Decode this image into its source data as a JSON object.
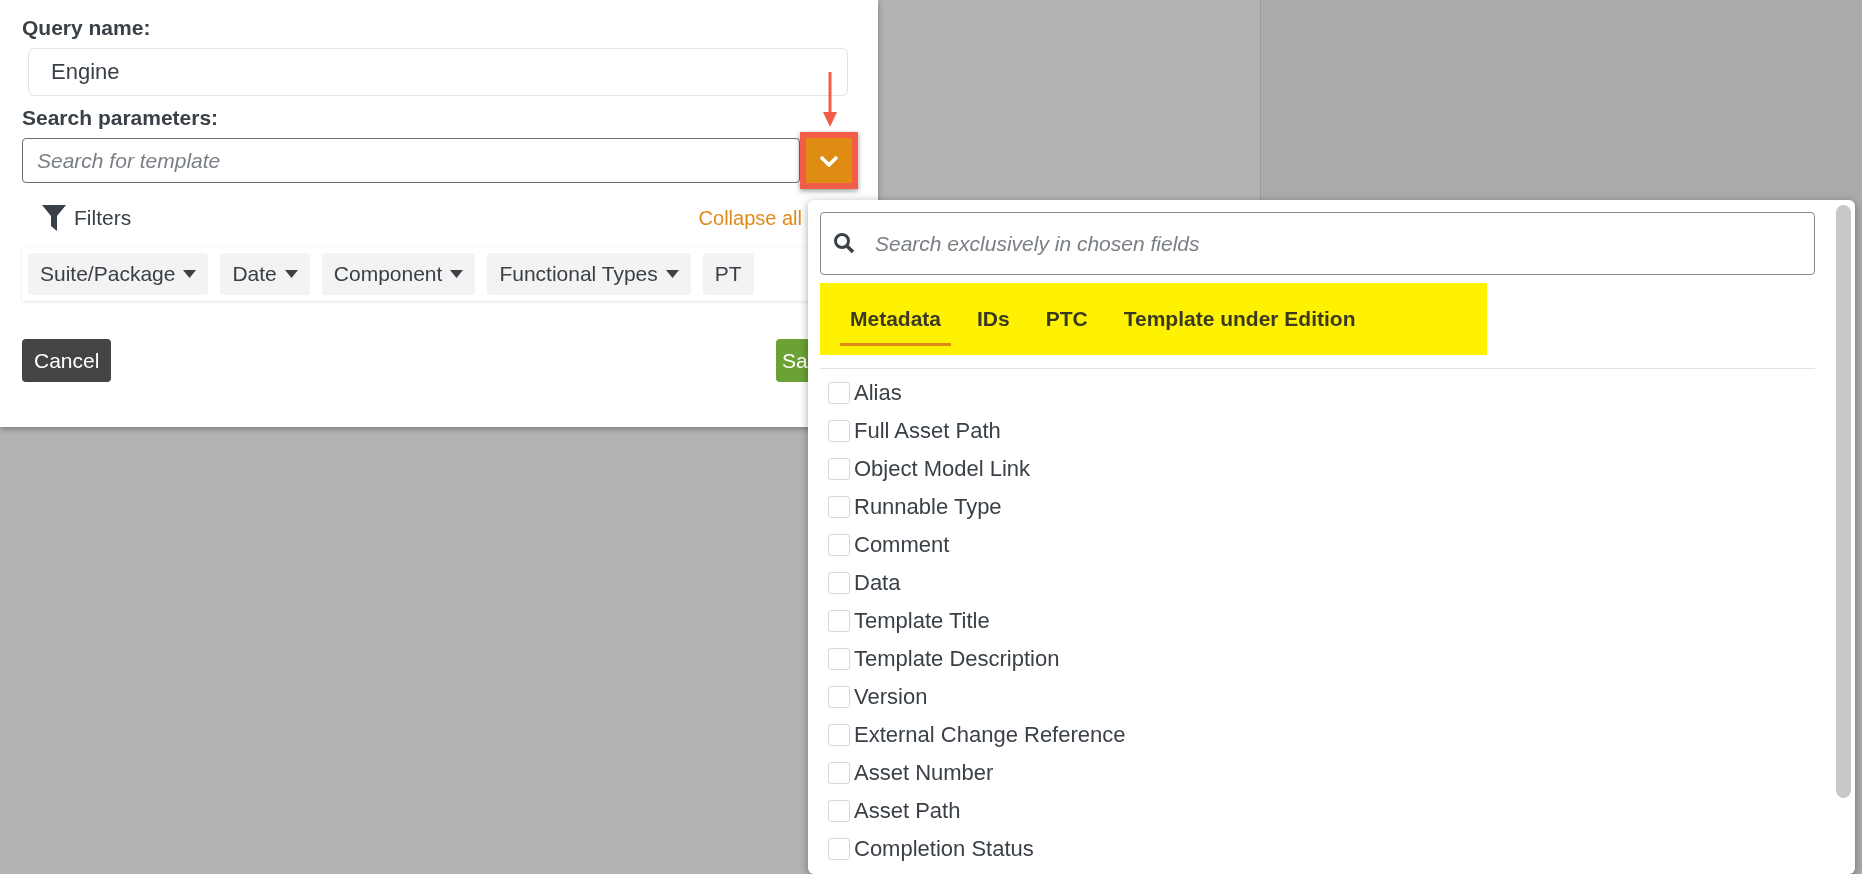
{
  "dialog": {
    "query_name_label": "Query name:",
    "query_name_value": "Engine",
    "search_label": "Search parameters:",
    "search_placeholder": "Search for template",
    "filters_label": "Filters",
    "collapse_all": "Collapse all",
    "chips": [
      "Suite/Package",
      "Date",
      "Component",
      "Functional Types",
      "PT"
    ],
    "cancel": "Cancel",
    "save": "Sa"
  },
  "dropdown": {
    "search_placeholder": "Search exclusively in chosen fields",
    "tabs": [
      {
        "label": "Metadata",
        "selected": true
      },
      {
        "label": "IDs",
        "selected": false
      },
      {
        "label": "PTC",
        "selected": false
      },
      {
        "label": "Template under Edition",
        "selected": false
      }
    ],
    "fields": [
      {
        "label": "Alias",
        "checked": false
      },
      {
        "label": "Full Asset Path",
        "checked": false
      },
      {
        "label": "Object Model Link",
        "checked": false
      },
      {
        "label": "Runnable Type",
        "checked": false
      },
      {
        "label": "Comment",
        "checked": false
      },
      {
        "label": "Data",
        "checked": false
      },
      {
        "label": "Template Title",
        "checked": false
      },
      {
        "label": "Template Description",
        "checked": false
      },
      {
        "label": "Version",
        "checked": false
      },
      {
        "label": "External Change Reference",
        "checked": false
      },
      {
        "label": "Asset Number",
        "checked": false
      },
      {
        "label": "Asset Path",
        "checked": false
      },
      {
        "label": "Completion Status",
        "checked": false
      }
    ]
  }
}
